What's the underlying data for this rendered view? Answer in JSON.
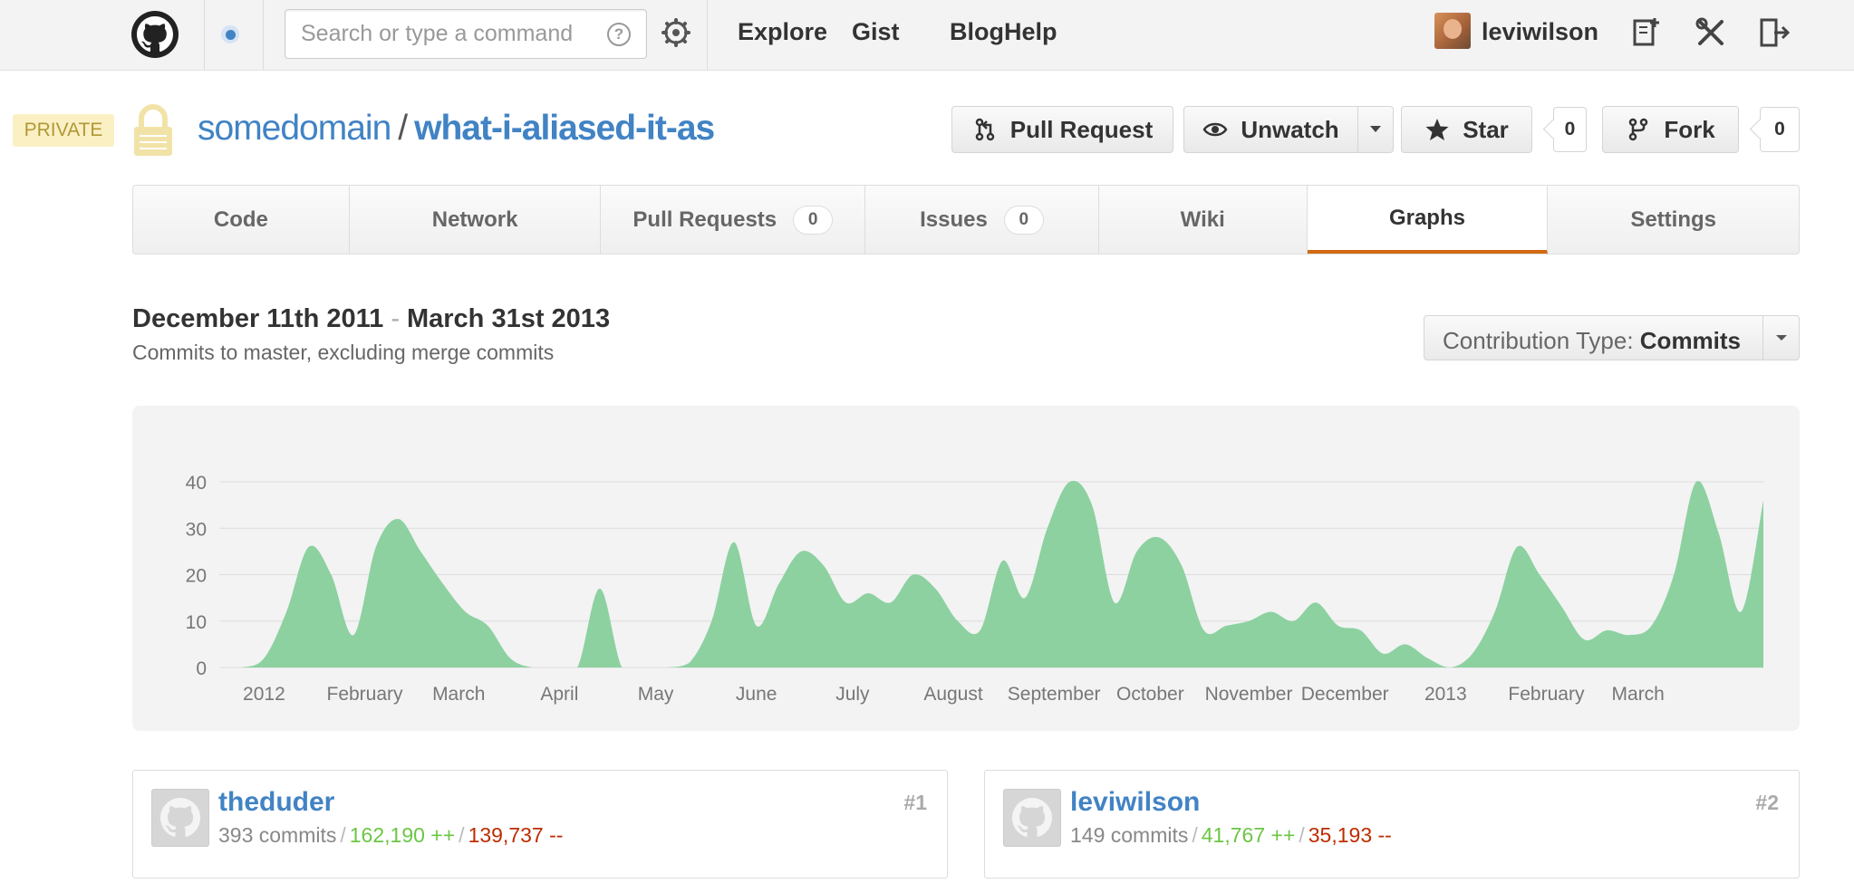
{
  "header": {
    "search_placeholder": "Search or type a command",
    "search_help": "?",
    "nav": [
      "Explore",
      "Gist",
      "Blog",
      "Help"
    ],
    "username": "leviwilson"
  },
  "repo": {
    "visibility": "PRIVATE",
    "owner": "somedomain",
    "separator": "/",
    "name": "what-i-aliased-it-as",
    "pull_request_label": "Pull Request",
    "unwatch_label": "Unwatch",
    "star_label": "Star",
    "star_count": "0",
    "fork_label": "Fork",
    "fork_count": "0"
  },
  "tabs": [
    {
      "label": "Code"
    },
    {
      "label": "Network"
    },
    {
      "label": "Pull Requests",
      "count": "0"
    },
    {
      "label": "Issues",
      "count": "0"
    },
    {
      "label": "Wiki"
    },
    {
      "label": "Graphs",
      "active": true
    },
    {
      "label": "Settings"
    }
  ],
  "graph": {
    "start_date": "December 11th 2011",
    "range_separator": "-",
    "end_date": "March 31st 2013",
    "subtitle": "Commits to master, excluding merge commits",
    "contribution_type_label": "Contribution Type:",
    "contribution_type_value": "Commits"
  },
  "chart_data": {
    "type": "area",
    "color": "#8dd1a1",
    "grid": true,
    "ylim": [
      0,
      40
    ],
    "yticks": [
      0,
      10,
      20,
      30,
      40
    ],
    "xlabels": [
      "2012",
      "February",
      "March",
      "April",
      "May",
      "June",
      "July",
      "August",
      "September",
      "October",
      "November",
      "December",
      "2013",
      "February",
      "March"
    ],
    "x_week_index": [
      2,
      6.5,
      10.7,
      15.2,
      19.5,
      24,
      28.3,
      32.8,
      37.3,
      41.6,
      46,
      50.3,
      54.8,
      59.3,
      63.4
    ],
    "series": [
      {
        "values": [
          0,
          0,
          2,
          12,
          26,
          20,
          7,
          26,
          32,
          25,
          18,
          12,
          9,
          2,
          0,
          0,
          0,
          17,
          0,
          0,
          0,
          1,
          10,
          27,
          9,
          18,
          25,
          22,
          14,
          16,
          14,
          20,
          17,
          10,
          8,
          23,
          15,
          30,
          40,
          35,
          14,
          25,
          28,
          22,
          8,
          9,
          10,
          12,
          10,
          14,
          9,
          8,
          3,
          5,
          2,
          0,
          3,
          12,
          26,
          20,
          13,
          6,
          8,
          7,
          9,
          20,
          40,
          29,
          12,
          36
        ]
      }
    ]
  },
  "contributors": [
    {
      "name": "theduder",
      "rank": "#1",
      "commits": "393 commits",
      "additions": "162,190 ++",
      "deletions": "139,737 --"
    },
    {
      "name": "leviwilson",
      "rank": "#2",
      "commits": "149 commits",
      "additions": "41,767 ++",
      "deletions": "35,193 --"
    }
  ]
}
